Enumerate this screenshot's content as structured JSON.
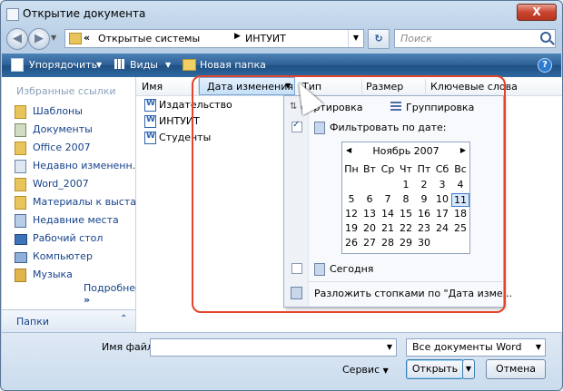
{
  "window": {
    "title": "Открытие документа",
    "close_label": "X"
  },
  "address": {
    "segments": [
      "Открытые системы",
      "ИНТУИТ"
    ],
    "search_placeholder": "Поиск"
  },
  "toolbar": {
    "organize": "Упорядочить",
    "views": "Виды",
    "new_folder": "Новая папка",
    "help": "?"
  },
  "sidebar": {
    "title": "Избранные ссылки",
    "items": [
      {
        "label": "Шаблоны",
        "icon": "folder-icon"
      },
      {
        "label": "Документы",
        "icon": "documents-icon"
      },
      {
        "label": "Office 2007",
        "icon": "folder-icon"
      },
      {
        "label": "Недавно измененн...",
        "icon": "recent-docs-icon"
      },
      {
        "label": "Word_2007",
        "icon": "folder-icon"
      },
      {
        "label": "Материалы к выста...",
        "icon": "folder-icon"
      },
      {
        "label": "Недавние места",
        "icon": "recent-places-icon"
      },
      {
        "label": "Рабочий стол",
        "icon": "desktop-icon"
      },
      {
        "label": "Компьютер",
        "icon": "computer-icon"
      },
      {
        "label": "Музыка",
        "icon": "music-icon"
      }
    ],
    "more": "Подробнее",
    "folders": "Папки"
  },
  "columns": [
    "Имя",
    "Дата изменения",
    "Тип",
    "Размер",
    "Ключевые слова"
  ],
  "files": [
    "Издательство",
    "ИНТУИТ",
    "Студенты"
  ],
  "menu": {
    "sort": "Сортировка",
    "group": "Группировка",
    "filter_by_date": "Фильтровать по дате:",
    "today": "Сегодня",
    "stack": "Разложить стопками по \"Дата изме..."
  },
  "calendar": {
    "month": "Ноябрь 2007",
    "weekdays": [
      "Пн",
      "Вт",
      "Ср",
      "Чт",
      "Пт",
      "Сб",
      "Вс"
    ],
    "weeks": [
      [
        "",
        "",
        "",
        "1",
        "2",
        "3",
        "4"
      ],
      [
        "5",
        "6",
        "7",
        "8",
        "9",
        "10",
        "11"
      ],
      [
        "12",
        "13",
        "14",
        "15",
        "16",
        "17",
        "18"
      ],
      [
        "19",
        "20",
        "21",
        "22",
        "23",
        "24",
        "25"
      ],
      [
        "26",
        "27",
        "28",
        "29",
        "30",
        "",
        ""
      ]
    ],
    "today": "11"
  },
  "bottom": {
    "filename_label": "Имя файла:",
    "filename_value": "",
    "file_type": "Все документы Word",
    "service": "Сервис",
    "open": "Открыть",
    "cancel": "Отмена"
  }
}
